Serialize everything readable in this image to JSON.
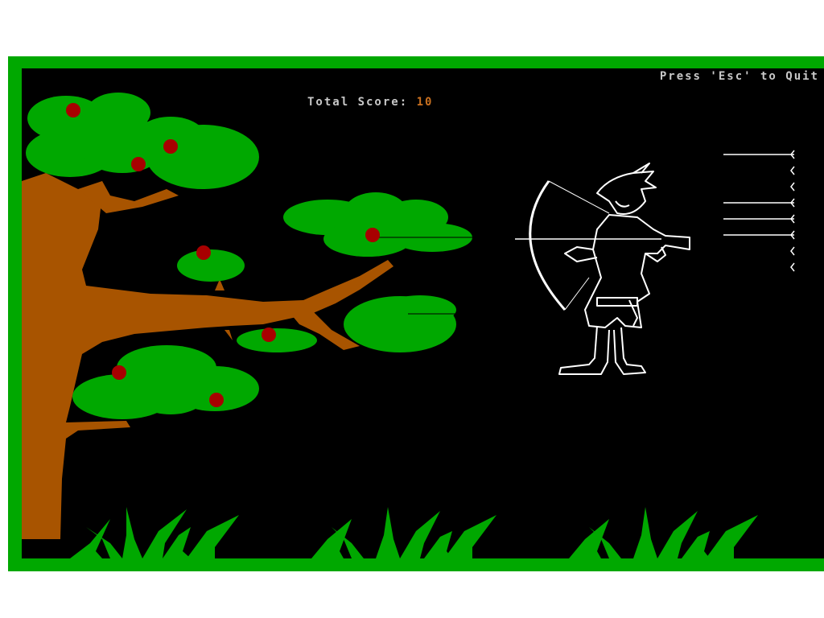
{
  "hud": {
    "quit_hint": "Press 'Esc' to Quit",
    "score_label": "Total Score:",
    "score_value": "10"
  },
  "scene": {
    "tree": {
      "apples_on_tree": 8
    },
    "quiver": {
      "arrows_remaining": 8,
      "arrows_full_length": 3
    },
    "archer": {
      "facing": "left",
      "bow_drawn": true,
      "arrow_fired": true
    },
    "icons": [
      "tree",
      "apple",
      "archer",
      "bow",
      "arrow",
      "grass"
    ]
  },
  "colors": {
    "frame": "#00a800",
    "background": "#000000",
    "leaves": "#00a800",
    "trunk": "#a85400",
    "apple": "#a80000",
    "archer_lines": "#ffffff",
    "hud_text": "#c8c8c8",
    "score_value": "#c87020"
  }
}
